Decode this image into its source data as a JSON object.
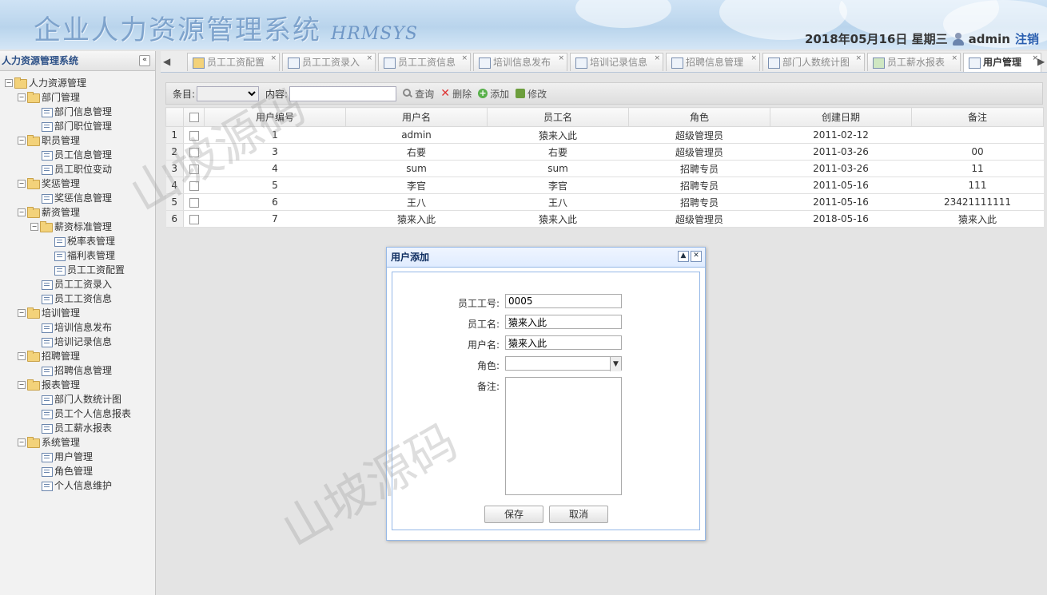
{
  "header": {
    "title": "企业人力资源管理系统",
    "subtitle": "HRMSYS",
    "date_text": "2018年05月16日 星期三",
    "username": "admin",
    "logout_label": "注销"
  },
  "sidebar": {
    "title": "人力资源管理系统",
    "tree": [
      {
        "label": "人力资源管理",
        "level": 0,
        "type": "folder"
      },
      {
        "label": "部门管理",
        "level": 1,
        "type": "folder"
      },
      {
        "label": "部门信息管理",
        "level": 2,
        "type": "page"
      },
      {
        "label": "部门职位管理",
        "level": 2,
        "type": "page"
      },
      {
        "label": "职员管理",
        "level": 1,
        "type": "folder"
      },
      {
        "label": "员工信息管理",
        "level": 2,
        "type": "page"
      },
      {
        "label": "员工职位变动",
        "level": 2,
        "type": "page"
      },
      {
        "label": "奖惩管理",
        "level": 1,
        "type": "folder"
      },
      {
        "label": "奖惩信息管理",
        "level": 2,
        "type": "page"
      },
      {
        "label": "薪资管理",
        "level": 1,
        "type": "folder"
      },
      {
        "label": "薪资标准管理",
        "level": 2,
        "type": "folder"
      },
      {
        "label": "税率表管理",
        "level": 3,
        "type": "page"
      },
      {
        "label": "福利表管理",
        "level": 3,
        "type": "page"
      },
      {
        "label": "员工工资配置",
        "level": 3,
        "type": "page"
      },
      {
        "label": "员工工资录入",
        "level": 2,
        "type": "page"
      },
      {
        "label": "员工工资信息",
        "level": 2,
        "type": "page"
      },
      {
        "label": "培训管理",
        "level": 1,
        "type": "folder"
      },
      {
        "label": "培训信息发布",
        "level": 2,
        "type": "page"
      },
      {
        "label": "培训记录信息",
        "level": 2,
        "type": "page"
      },
      {
        "label": "招聘管理",
        "level": 1,
        "type": "folder"
      },
      {
        "label": "招聘信息管理",
        "level": 2,
        "type": "page"
      },
      {
        "label": "报表管理",
        "level": 1,
        "type": "folder"
      },
      {
        "label": "部门人数统计图",
        "level": 2,
        "type": "page"
      },
      {
        "label": "员工个人信息报表",
        "level": 2,
        "type": "page"
      },
      {
        "label": "员工薪水报表",
        "level": 2,
        "type": "page"
      },
      {
        "label": "系统管理",
        "level": 1,
        "type": "folder"
      },
      {
        "label": "用户管理",
        "level": 2,
        "type": "page"
      },
      {
        "label": "角色管理",
        "level": 2,
        "type": "page"
      },
      {
        "label": "个人信息维护",
        "level": 2,
        "type": "page"
      }
    ]
  },
  "tabs": [
    {
      "label": "员工工资配置",
      "icon": "wallet-icon",
      "active": false
    },
    {
      "label": "员工工资录入",
      "icon": "edit-icon",
      "active": false
    },
    {
      "label": "员工工资信息",
      "icon": "table-icon",
      "active": false
    },
    {
      "label": "培训信息发布",
      "icon": "list-icon",
      "active": false
    },
    {
      "label": "培训记录信息",
      "icon": "table-icon",
      "active": false
    },
    {
      "label": "招聘信息管理",
      "icon": "list-icon",
      "active": false
    },
    {
      "label": "部门人数统计图",
      "icon": "bar-chart-icon",
      "active": false
    },
    {
      "label": "员工薪水报表",
      "icon": "yen-icon",
      "active": false
    },
    {
      "label": "用户管理",
      "icon": "user-card-icon",
      "active": true
    }
  ],
  "toolbar": {
    "field_label": "条目:",
    "keyword_label": "内容:",
    "search_label": "查询",
    "delete_label": "删除",
    "add_label": "添加",
    "edit_label": "修改"
  },
  "grid": {
    "columns": [
      "用户编号",
      "用户名",
      "员工名",
      "角色",
      "创建日期",
      "备注"
    ],
    "rows": [
      {
        "rn": "1",
        "cells": [
          "1",
          "admin",
          "猿来入此",
          "超级管理员",
          "2011-02-12",
          ""
        ]
      },
      {
        "rn": "2",
        "cells": [
          "3",
          "右要",
          "右要",
          "超级管理员",
          "2011-03-26",
          "00"
        ]
      },
      {
        "rn": "3",
        "cells": [
          "4",
          "sum",
          "sum",
          "招聘专员",
          "2011-03-26",
          "11"
        ]
      },
      {
        "rn": "4",
        "cells": [
          "5",
          "李官",
          "李官",
          "招聘专员",
          "2011-05-16",
          "111"
        ]
      },
      {
        "rn": "5",
        "cells": [
          "6",
          "王八",
          "王八",
          "招聘专员",
          "2011-05-16",
          "23421111111"
        ]
      },
      {
        "rn": "6",
        "cells": [
          "7",
          "猿来入此",
          "猿来入此",
          "超级管理员",
          "2018-05-16",
          "猿来入此"
        ]
      }
    ]
  },
  "dialog": {
    "title": "用户添加",
    "emp_no_label": "员工工号:",
    "emp_no_value": "0005",
    "emp_name_label": "员工名:",
    "emp_name_value": "猿来入此",
    "user_name_label": "用户名:",
    "user_name_value": "猿来入此",
    "role_label": "角色:",
    "role_value": "",
    "remark_label": "备注:",
    "remark_value": "",
    "save_label": "保存",
    "cancel_label": "取消"
  },
  "watermark": "山坡源码"
}
